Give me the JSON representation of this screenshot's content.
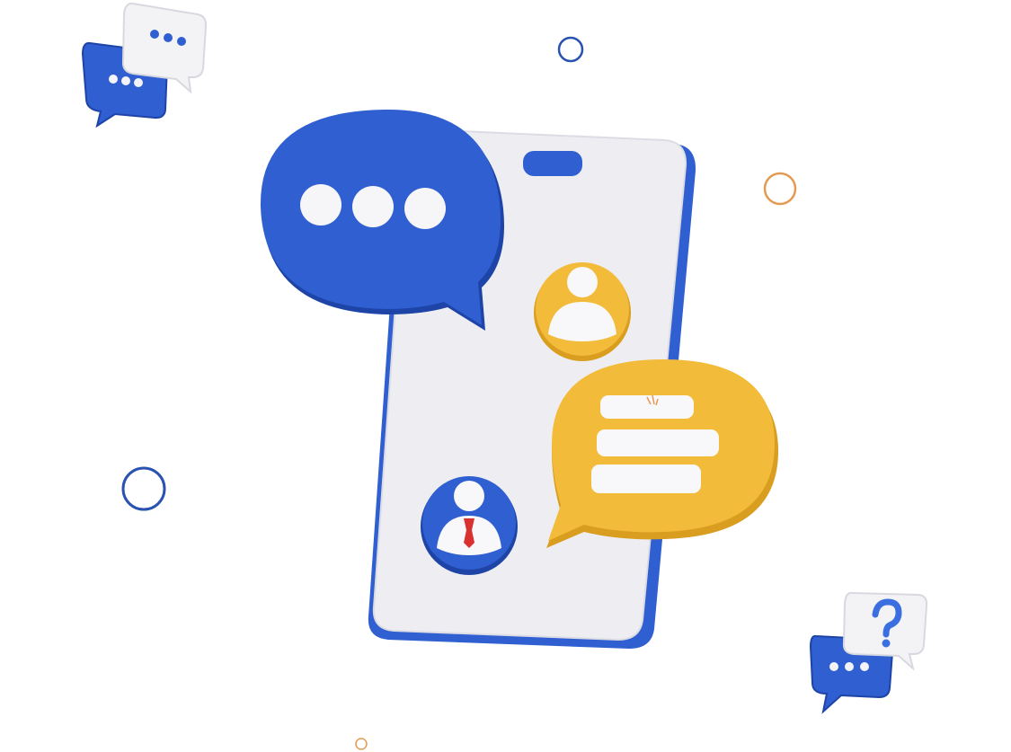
{
  "colors": {
    "primary_blue": "#2f5fd0",
    "dark_blue": "#1d44a6",
    "accent_yellow": "#f2bb3a",
    "dark_yellow": "#d99d1f",
    "phone_screen": "#eeeef2",
    "white": "#fbfbfd",
    "ring_blue": "#2a52b0",
    "ring_orange": "#e59a52",
    "tie_red": "#d93030",
    "question_blue": "#3b6fe0"
  },
  "icons": [
    "chat-bubbles-icon",
    "phone-icon",
    "typing-bubble-icon",
    "user-avatar-icon",
    "business-user-avatar-icon",
    "message-bubble-icon",
    "question-chat-icon"
  ]
}
